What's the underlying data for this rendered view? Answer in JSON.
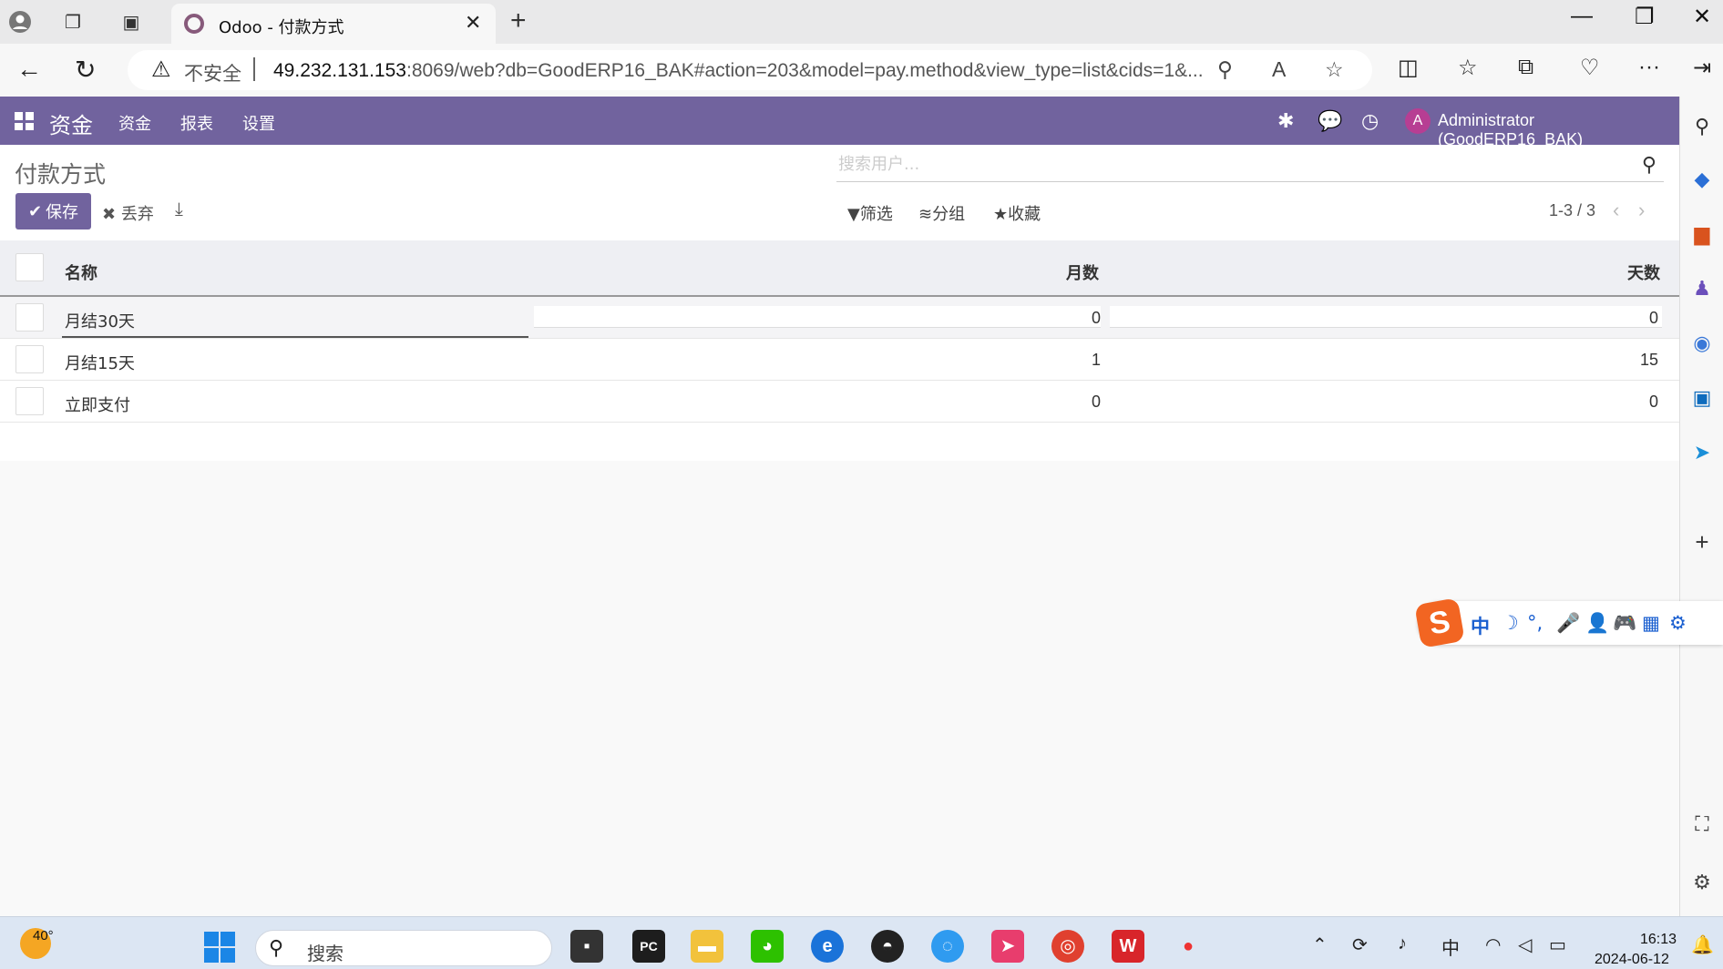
{
  "browser": {
    "tab_title": "Odoo - 付款方式",
    "security_label": "不安全",
    "url_host": "49.232.131.153",
    "url_rest": ":8069/web?db=GoodERP16_BAK#action=203&model=pay.method&view_type=list&cids=1&..."
  },
  "navbar": {
    "brand": "资金",
    "menu": [
      "资金",
      "报表",
      "设置"
    ],
    "avatar_letter": "A",
    "user": "Administrator (GoodERP16_BAK)"
  },
  "control_panel": {
    "breadcrumb": "付款方式",
    "save_label": "保存",
    "discard_label": "丢弃",
    "search_placeholder": "搜索用户...",
    "filter_label": "筛选",
    "group_label": "分组",
    "favorites_label": "收藏",
    "pager": "1-3 / 3"
  },
  "table": {
    "columns": [
      "名称",
      "月数",
      "天数"
    ],
    "rows": [
      {
        "name": "月结30天",
        "months": "0",
        "days": "0"
      },
      {
        "name": "月结15天",
        "months": "1",
        "days": "15"
      },
      {
        "name": "立即支付",
        "months": "0",
        "days": "0"
      }
    ]
  },
  "ime": {
    "items": [
      "中",
      "☽",
      "°,",
      "🎤",
      "👤",
      "🎮",
      "▦",
      "⚙"
    ]
  },
  "taskbar": {
    "weather_temp": "40°",
    "search_label": "搜索",
    "time": "16:13",
    "date": "2024-06-12"
  },
  "colors": {
    "brand_purple": "#71639e",
    "odoo_favicon": "#875a7b"
  }
}
